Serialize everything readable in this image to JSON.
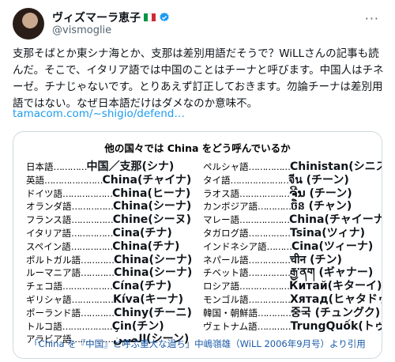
{
  "author": {
    "name": "ヴィズマーラ恵子",
    "handle": "@vismoglie",
    "flag_colors": [
      "#009246",
      "#ffffff",
      "#ce2b37"
    ],
    "verified_color": "#1d9bf0"
  },
  "post": {
    "text": "支那そばとか東シナ海とか、支那は差別用語だそうで？WiLLさんの記事も読んだ。そこで、イタリア語では中国のことはチーナと呼びます。中国人はチネーゼ。チナじゃないです。とりあえず訂正しておきます。勿論チーナは差別用語ではない。なぜ日本語だけはダメなのか意味不。",
    "link": "tamacom.com/~shigio/defend…"
  },
  "card": {
    "title": "他の国々では China をどう呼んでいるか",
    "left": [
      {
        "lang": "日本語",
        "dots": "…………",
        "name": "中国／支那(シナ)"
      },
      {
        "lang": "英語",
        "dots": "…………………",
        "name": "China(チャイナ)"
      },
      {
        "lang": "ドイツ語",
        "dots": "………………",
        "name": "China(ヒーナ)"
      },
      {
        "lang": "オランダ語",
        "dots": "……………",
        "name": "China(シーナ)"
      },
      {
        "lang": "フランス語",
        "dots": "……………",
        "name": "Chine(シーヌ)"
      },
      {
        "lang": "イタリア語",
        "dots": "……………",
        "name": "Cina(チナ)"
      },
      {
        "lang": "スペイン語",
        "dots": "……………",
        "name": "China(チナ)"
      },
      {
        "lang": "ポルトガル語",
        "dots": "…………",
        "name": "China(シーナ)"
      },
      {
        "lang": "ルーマニア語",
        "dots": "…………",
        "name": "China(シーナ)"
      },
      {
        "lang": "チェコ語",
        "dots": "………………",
        "name": "Cína(チナ)"
      },
      {
        "lang": "ギリシャ語",
        "dots": "……………",
        "name": "Kíva(キーナ)"
      },
      {
        "lang": "ポーランド語",
        "dots": "…………",
        "name": "Chiny(チーニ)"
      },
      {
        "lang": "トルコ語",
        "dots": "………………",
        "name": "Çin(チン)"
      },
      {
        "lang": "アラビア語",
        "dots": "……………",
        "name": "الصين(シーン)"
      }
    ],
    "right": [
      {
        "lang": "ペルシャ語",
        "dots": "……………",
        "name": "Chinistan(シニスタン)"
      },
      {
        "lang": "タイ語",
        "dots": "…………………",
        "name": "จีน (チーン)"
      },
      {
        "lang": "ラオス語",
        "dots": "………………",
        "name": "ຈີນ (チーン)"
      },
      {
        "lang": "カンボジア語",
        "dots": "…………",
        "name": "ចិន (チャン)"
      },
      {
        "lang": "マレー語",
        "dots": "………………",
        "name": "China(チャイーナ)"
      },
      {
        "lang": "タガログ語",
        "dots": "……………",
        "name": "Tsina(ツィナ)"
      },
      {
        "lang": "インドネシア語",
        "dots": "………",
        "name": "Cina(ツィーナ)"
      },
      {
        "lang": "ネパール語",
        "dots": "……………",
        "name": "चीन (チン)"
      },
      {
        "lang": "チベット語",
        "dots": "……………",
        "name": "རྒྱ་ནག (ギャナー)"
      },
      {
        "lang": "ロシア語",
        "dots": "………………",
        "name": "Китай(キターイ)"
      },
      {
        "lang": "モンゴル語",
        "dots": "……………",
        "name": "Хятад(ヒャタドゥ)"
      },
      {
        "lang": "韓国・朝鮮語",
        "dots": "…………",
        "name": "중국 (チュングク)"
      },
      {
        "lang": "ヴェトナム語",
        "dots": "…………",
        "name": "TrungQuốk(トゥルンコック)"
      }
    ],
    "caption": "「China を『中国』と呼ぶ重大な過ち」中嶋嶺雄（WiLL 2006年9月号）より引用"
  }
}
